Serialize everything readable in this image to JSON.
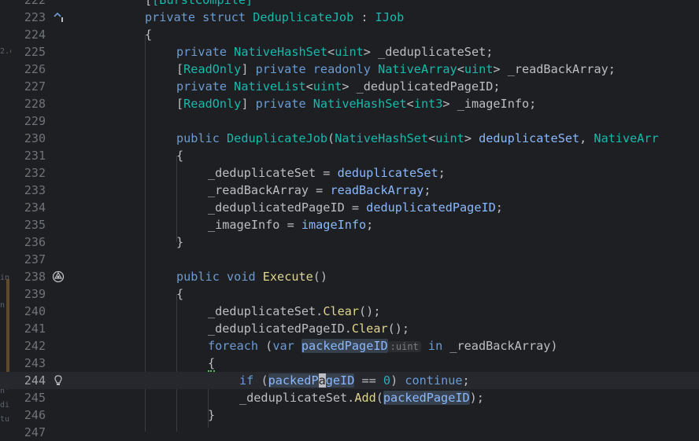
{
  "sidebar_fragments": [
    "2.c",
    "in",
    "n",
    "n'",
    "di",
    "tu"
  ],
  "lines": [
    {
      "n": "222"
    },
    {
      "n": "223"
    },
    {
      "n": "224"
    },
    {
      "n": "225"
    },
    {
      "n": "226"
    },
    {
      "n": "227"
    },
    {
      "n": "228"
    },
    {
      "n": "229"
    },
    {
      "n": "230"
    },
    {
      "n": "231"
    },
    {
      "n": "232"
    },
    {
      "n": "233"
    },
    {
      "n": "234"
    },
    {
      "n": "235"
    },
    {
      "n": "236"
    },
    {
      "n": "237"
    },
    {
      "n": "238"
    },
    {
      "n": "239"
    },
    {
      "n": "240"
    },
    {
      "n": "241"
    },
    {
      "n": "242"
    },
    {
      "n": "243"
    },
    {
      "n": "244"
    },
    {
      "n": "245"
    },
    {
      "n": "246"
    },
    {
      "n": "247"
    }
  ],
  "code": {
    "l222": "[BurstCompile]",
    "l223_kw1": "private",
    "l223_kw2": "struct",
    "l223_name": "DeduplicateJob",
    "l223_colon": " : ",
    "l223_iface": "IJob",
    "brace_open": "{",
    "brace_close": "}",
    "private": "private",
    "public": "public",
    "readonly": "readonly",
    "ReadOnly": "ReadOnly",
    "void": "void",
    "var": "var",
    "in": "in",
    "if": "if",
    "foreach": "foreach",
    "continue": "continue",
    "uint": "uint",
    "int3": "int3",
    "NativeHashSet": "NativeHashSet",
    "NativeArray": "NativeArray",
    "NativeList": "NativeList",
    "NativeArr": "NativeArr",
    "_deduplicateSet": "_deduplicateSet",
    "_readBackArray": "_readBackArray",
    "_deduplicatedPageID": "_deduplicatedPageID",
    "_imageInfo": "_imageInfo",
    "DeduplicateJob": "DeduplicateJob",
    "deduplicateSet": "deduplicateSet",
    "readBackArray": "readBackArray",
    "deduplicatedPageID": "deduplicatedPageID",
    "imageInfo": "imageInfo",
    "Execute": "Execute",
    "Clear": "Clear",
    "Add": "Add",
    "packedPageID": "packedPageID",
    "packedP": "packedP",
    "a": "a",
    "geID": "geID",
    "hint_uint": ":uint",
    "zero": "0"
  },
  "icons": {
    "line223": "implements-up-arrow-icon",
    "line238": "unity-icon",
    "line244": "debug-bulb-icon"
  }
}
